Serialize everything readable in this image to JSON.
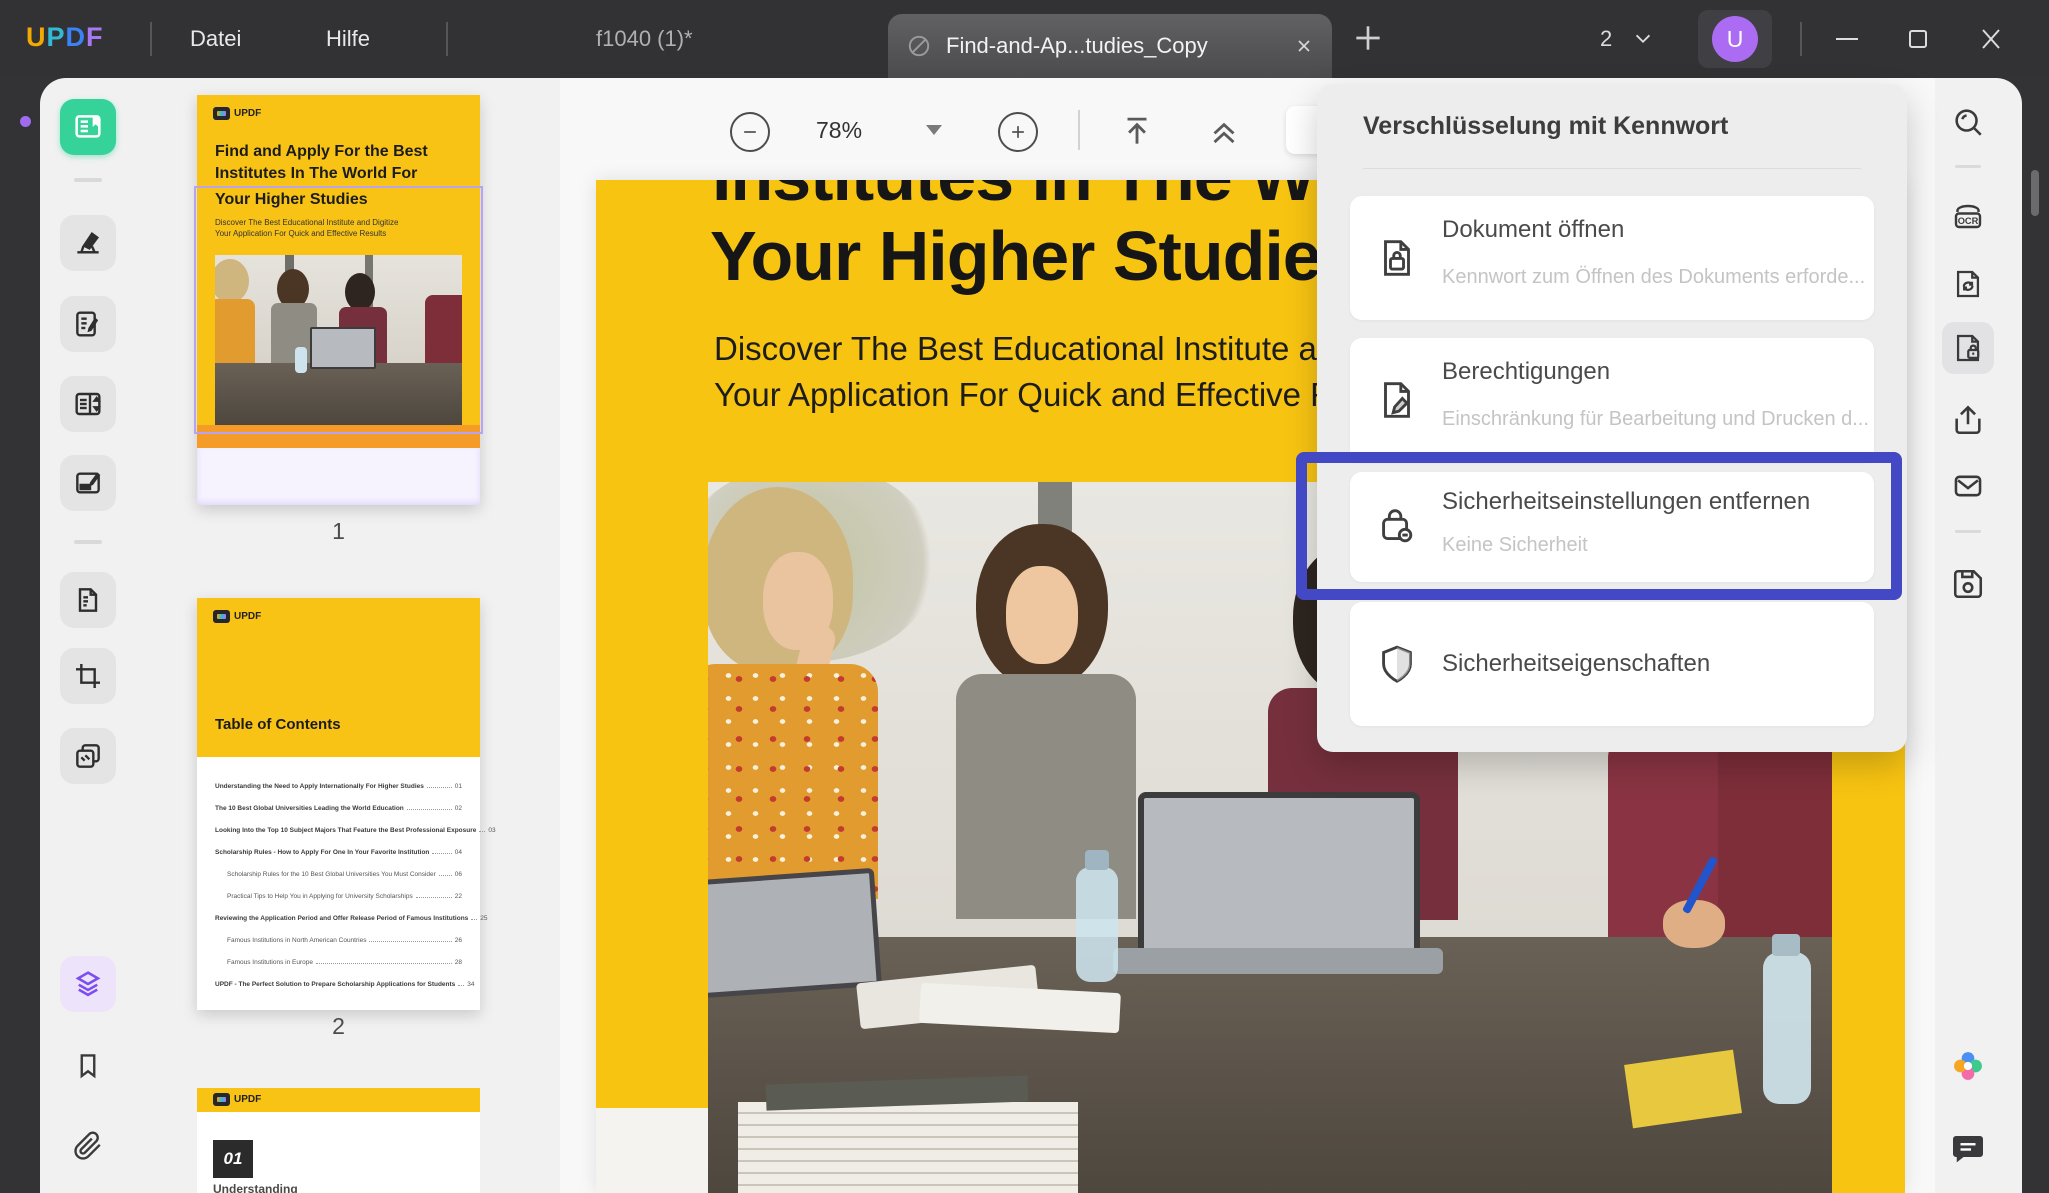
{
  "titlebar": {
    "logo_letters": [
      "U",
      "P",
      "D",
      "F"
    ],
    "menu_datei": "Datei",
    "menu_hilfe": "Hilfe",
    "inactive_tab_label": "f1040 (1)*",
    "active_tab_label": "Find-and-Ap...tudies_Copy",
    "open_docs_count": "2",
    "avatar_initial": "U"
  },
  "icons": {
    "window_controls": [
      "minimize",
      "maximize",
      "close"
    ],
    "left_rail": [
      "reader",
      "highlighter",
      "edit-page",
      "split-view",
      "sign-page",
      "convert-pages",
      "crop",
      "stamp",
      "page-thumbnails",
      "bookmark",
      "attachment"
    ],
    "right_rail": [
      "search",
      "ocr",
      "convert-document",
      "document-security",
      "share",
      "mail",
      "save",
      "updf-ai",
      "feedback-chat"
    ],
    "tab_icon": "encrypted-slash-circle"
  },
  "colors": {
    "accent_green": "#35D399",
    "accent_purple": "#8B5CF6",
    "highlight_blue": "#4348C4",
    "cover_yellow": "#F8C412",
    "avatar_purple": "#AB6BF2"
  },
  "toolbar": {
    "zoom_value": "78%"
  },
  "thumbnails": {
    "page1": {
      "logo": "UPDF",
      "heading_line1": "Find and Apply For the Best",
      "heading_line2": "Institutes In The World For",
      "heading_line3": "Your Higher Studies",
      "sub_line1": "Discover The Best Educational Institute and Digitize",
      "sub_line2": "Your Application For Quick and Effective Results",
      "number": "1"
    },
    "page2": {
      "logo": "UPDF",
      "title": "Table of Contents",
      "number": "2",
      "entries": [
        {
          "text": "Understanding the Need to Apply Internationally For Higher Studies",
          "page": "01",
          "indent": false
        },
        {
          "text": "The 10 Best Global Universities Leading the World Education",
          "page": "02",
          "indent": false
        },
        {
          "text": "Looking Into the Top 10 Subject Majors That Feature the Best Professional Exposure",
          "page": "03",
          "indent": false
        },
        {
          "text": "Scholarship Rules - How to Apply For One In Your Favorite Institution",
          "page": "04",
          "indent": false
        },
        {
          "text": "Scholarship Rules for the 10 Best Global Universities You Must Consider",
          "page": "06",
          "indent": true
        },
        {
          "text": "Practical Tips to Help You in Applying for University Scholarships",
          "page": "22",
          "indent": true
        },
        {
          "text": "Reviewing the Application Period and Offer Release Period of Famous Institutions",
          "page": "25",
          "indent": false
        },
        {
          "text": "Famous Institutions in North American Countries",
          "page": "26",
          "indent": true
        },
        {
          "text": "Famous Institutions in Europe",
          "page": "28",
          "indent": true
        },
        {
          "text": "UPDF - The Perfect Solution to Prepare Scholarship Applications for Students",
          "page": "34",
          "indent": false
        }
      ]
    },
    "page3": {
      "logo": "UPDF",
      "badge": "01",
      "caption": "Understanding"
    }
  },
  "document": {
    "clipped_line": "Institutes In The W",
    "heading": "Your Higher Studies",
    "body_line1": "Discover The Best Educational Institute and",
    "body_line2": "Your Application For Quick and Effective Results"
  },
  "security_panel": {
    "title": "Verschlüsselung mit Kennwort",
    "items": [
      {
        "title": "Dokument öffnen",
        "subtitle": "Kennwort zum Öffnen des Dokuments erforde...",
        "icon": "document-lock"
      },
      {
        "title": "Berechtigungen",
        "subtitle": "Einschränkung für Bearbeitung und Drucken d...",
        "icon": "document-pen"
      },
      {
        "title": "Sicherheitseinstellungen entfernen",
        "subtitle": "Keine Sicherheit",
        "icon": "lock-remove",
        "highlighted": true
      },
      {
        "title": "Sicherheitseigenschaften",
        "subtitle": "",
        "icon": "shield"
      }
    ]
  }
}
